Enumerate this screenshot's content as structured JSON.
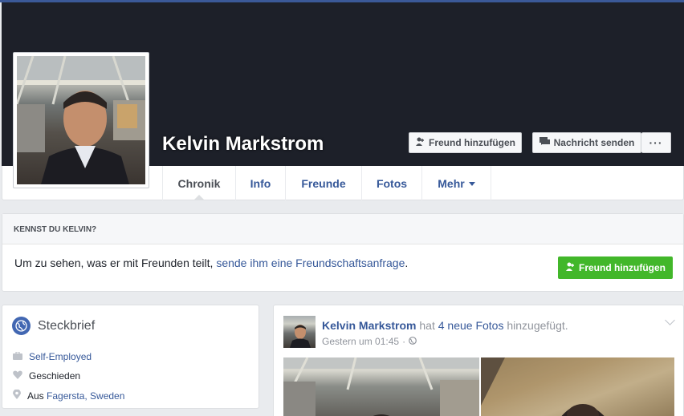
{
  "profile": {
    "name": "Kelvin Markstrom",
    "buttons": {
      "add_friend": "Freund hinzufügen",
      "send_message": "Nachricht senden",
      "more": "···"
    }
  },
  "tabs": [
    {
      "label": "Chronik",
      "active": true
    },
    {
      "label": "Info"
    },
    {
      "label": "Freunde"
    },
    {
      "label": "Fotos"
    },
    {
      "label": "Mehr"
    }
  ],
  "know_card": {
    "header": "KENNST DU KELVIN?",
    "text_before": "Um zu sehen, was er mit Freunden teilt, ",
    "link": "sende ihm eine Freundschaftsanfrage",
    "text_after": ".",
    "button": "Freund hinzufügen"
  },
  "intro": {
    "title": "Steckbrief",
    "work": "Self-Employed",
    "relationship": "Geschieden",
    "from_prefix": "Aus ",
    "from_place": "Fagersta, Sweden"
  },
  "post": {
    "author": "Kelvin Markstrom",
    "action_prefix": " hat ",
    "photos_link": "4 neue Fotos",
    "action_suffix": " hinzugefügt.",
    "timestamp": "Gestern um 01:45"
  },
  "colors": {
    "brand_blue": "#3b5998",
    "link_blue": "#365899",
    "cover_dark": "#1d2029",
    "green_button": "#42b72a",
    "page_bg": "#e9ebee"
  },
  "icons": {
    "add_friend": "add-friend-icon",
    "message": "message-icon",
    "globe": "globe-icon",
    "briefcase": "briefcase-icon",
    "heart": "heart-icon",
    "location": "location-pin-icon",
    "audience": "public-globe-icon",
    "post_options": "chevron-down-icon"
  }
}
